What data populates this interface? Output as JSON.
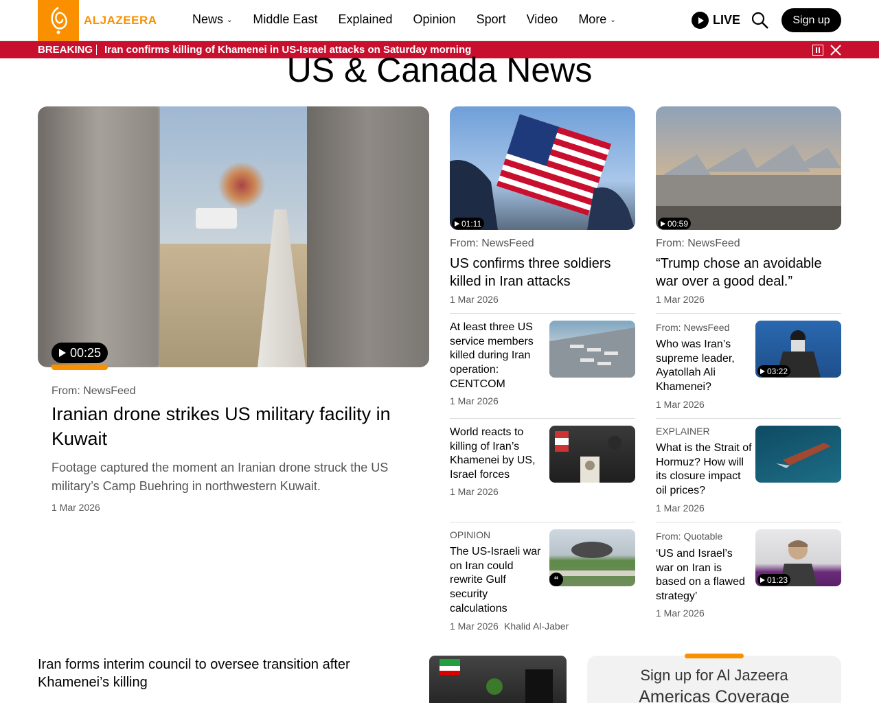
{
  "header": {
    "brand": "ALJAZEERA",
    "nav": [
      {
        "label": "News",
        "dropdown": true
      },
      {
        "label": "Middle East",
        "dropdown": false
      },
      {
        "label": "Explained",
        "dropdown": false
      },
      {
        "label": "Opinion",
        "dropdown": false
      },
      {
        "label": "Sport",
        "dropdown": false
      },
      {
        "label": "Video",
        "dropdown": false
      },
      {
        "label": "More",
        "dropdown": true
      }
    ],
    "live_label": "LIVE",
    "signup_label": "Sign up",
    "accent": "#fa9000"
  },
  "breaking": {
    "label": "BREAKING",
    "text": "Iran confirms killing of Khamenei in US-Israel attacks on Saturday morning",
    "color": "#c8102e"
  },
  "page_title": "US & Canada News",
  "featured": {
    "duration": "00:25",
    "source": "From: NewsFeed",
    "title": "Iranian drone strikes US military facility in Kuwait",
    "description": "Footage captured the moment an Iranian drone struck the US military’s Camp Buehring in northwestern Kuwait.",
    "date": "1 Mar 2026"
  },
  "col2": {
    "top": {
      "duration": "01:11",
      "source": "From: NewsFeed",
      "title": "US confirms three soldiers killed in Iran attacks",
      "date": "1 Mar 2026"
    },
    "items": [
      {
        "source": "",
        "title": "At least three US service members killed during Iran operation: CENTCOM",
        "date": "1 Mar 2026",
        "author": ""
      },
      {
        "source": "",
        "title": "World reacts to killing of Iran’s Khamenei by US, Israel forces",
        "date": "1 Mar 2026",
        "author": ""
      },
      {
        "source": "OPINION",
        "title": "The US-Israeli war on Iran could rewrite Gulf security calculations",
        "date": "1 Mar 2026",
        "author": "Khalid Al-Jaber"
      }
    ]
  },
  "col3": {
    "top": {
      "duration": "00:59",
      "source": "From: NewsFeed",
      "title": "“Trump chose an avoidable war over a good deal.”",
      "date": "1 Mar 2026"
    },
    "items": [
      {
        "source": "From: NewsFeed",
        "title": "Who was Iran’s supreme leader, Ayatollah Ali Khamenei?",
        "date": "1 Mar 2026",
        "duration": "03:22"
      },
      {
        "source": "EXPLAINER",
        "title": "What is the Strait of Hormuz? How will its closure impact oil prices?",
        "date": "1 Mar 2026",
        "duration": ""
      },
      {
        "source": "From: Quotable",
        "title": "‘US and Israel’s war on Iran is based on a flawed strategy’",
        "date": "1 Mar 2026",
        "duration": "01:23"
      }
    ]
  },
  "bottom": {
    "title": "Iran forms interim council to oversee transition after Khamenei’s killing",
    "newsletter_line1": "Sign up for Al Jazeera",
    "newsletter_line2": "Americas Coverage"
  }
}
